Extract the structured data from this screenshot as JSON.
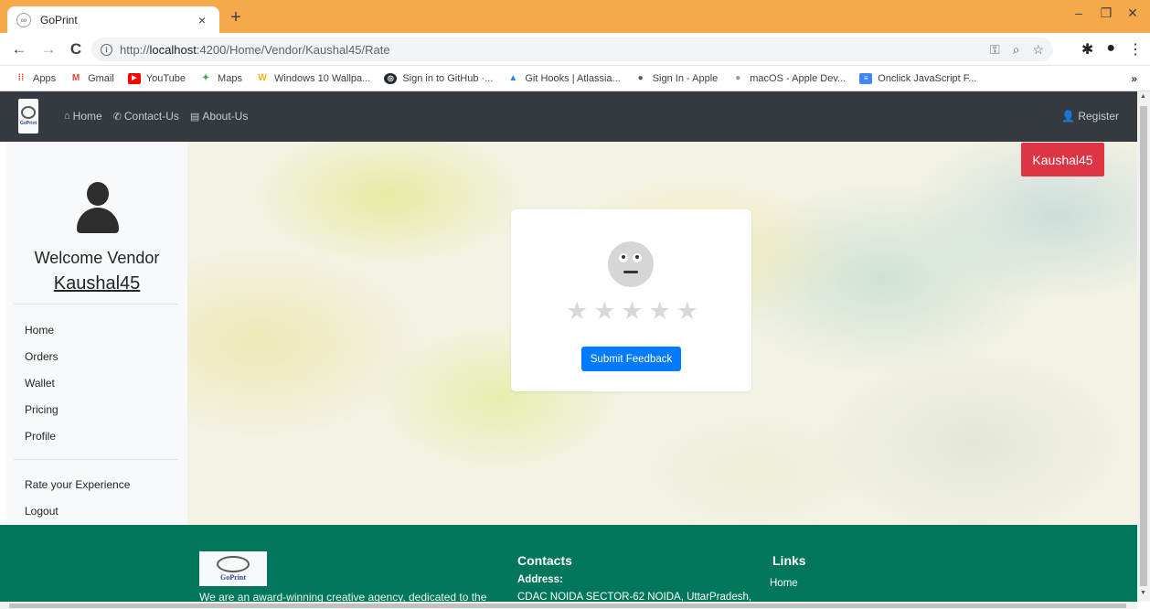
{
  "browser": {
    "tab_title": "GoPrint",
    "tab_close": "×",
    "new_tab": "+",
    "window": {
      "minimize": "–",
      "restore": "❐",
      "close": "✕"
    },
    "url_prefix": "http://",
    "url_host": "localhost",
    "url_rest": ":4200/Home/Vendor/Kaushal45/Rate",
    "bookmarks": [
      {
        "label": "Apps",
        "icon": "apps-grid-icon",
        "color": "#ea4335"
      },
      {
        "label": "Gmail",
        "icon": "gmail-icon",
        "color": "#ea4335"
      },
      {
        "label": "YouTube",
        "icon": "youtube-icon",
        "color": "#ff0000"
      },
      {
        "label": "Maps",
        "icon": "maps-icon",
        "color": "#34a853"
      },
      {
        "label": "Windows 10 Wallpa...",
        "icon": "wallpaper-w-icon",
        "color": "#f4b400"
      },
      {
        "label": "Sign in to GitHub ·...",
        "icon": "github-icon",
        "color": "#24292e"
      },
      {
        "label": "Git Hooks | Atlassia...",
        "icon": "atlassian-icon",
        "color": "#2684ff"
      },
      {
        "label": "Sign In - Apple",
        "icon": "apple-icon",
        "color": "#555555"
      },
      {
        "label": "macOS - Apple Dev...",
        "icon": "apple-icon",
        "color": "#999999"
      },
      {
        "label": "Onclick JavaScript F...",
        "icon": "docs-icon",
        "color": "#4285f4"
      }
    ],
    "bookmarks_more": "»"
  },
  "navbar": {
    "links": [
      {
        "label": "Home",
        "icon": "home-icon",
        "glyph": "⌂"
      },
      {
        "label": "Contact-Us",
        "icon": "phone-icon",
        "glyph": "✆"
      },
      {
        "label": "About-Us",
        "icon": "id-card-icon",
        "glyph": "▤"
      }
    ],
    "register": "Register",
    "logo_text": "GoPrint"
  },
  "sidebar": {
    "welcome": "Welcome Vendor",
    "vendor_name": "Kaushal45",
    "menu": [
      "Home",
      "Orders",
      "Wallet",
      "Pricing",
      "Profile"
    ],
    "extra": [
      "Rate your Experience",
      "Logout"
    ]
  },
  "main": {
    "user_badge": "Kaushal45",
    "rating": {
      "value": 0,
      "max": 5,
      "face": "neutral"
    },
    "submit_label": "Submit Feedback"
  },
  "footer": {
    "logo_text": "GoPrint",
    "tagline": "We are an award-winning creative agency, dedicated to the",
    "contacts_heading": "Contacts",
    "address_label": "Address:",
    "address": "CDAC NOIDA SECTOR-62 NOIDA, UttarPradesh,",
    "links_heading": "Links",
    "links": [
      "Home"
    ]
  },
  "colors": {
    "titlebar": "#f6a948",
    "navbar": "#343a40",
    "badge": "#dc3545",
    "submit": "#007bff",
    "footer": "#00765a"
  }
}
